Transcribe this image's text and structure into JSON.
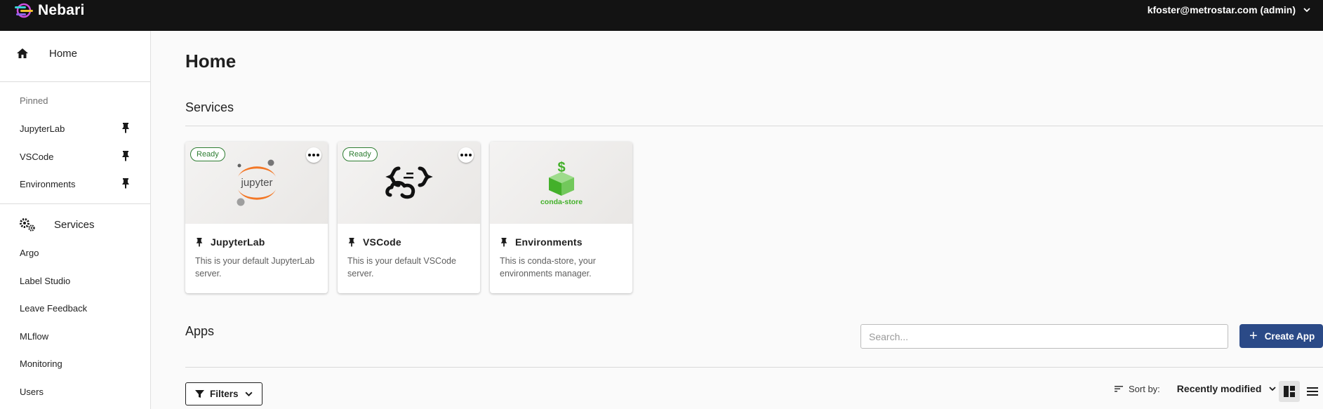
{
  "app": {
    "name": "Nebari"
  },
  "user": {
    "label": "kfoster@metrostar.com (admin)"
  },
  "sidebar": {
    "home_label": "Home",
    "pinned_heading": "Pinned",
    "pinned": [
      {
        "label": "JupyterLab"
      },
      {
        "label": "VSCode"
      },
      {
        "label": "Environments"
      }
    ],
    "services_heading": "Services",
    "services": [
      {
        "label": "Argo"
      },
      {
        "label": "Label Studio"
      },
      {
        "label": "Leave Feedback"
      },
      {
        "label": "MLflow"
      },
      {
        "label": "Monitoring"
      },
      {
        "label": "Users"
      }
    ]
  },
  "main": {
    "title": "Home",
    "services_title": "Services",
    "cards": [
      {
        "status": "Ready",
        "title": "JupyterLab",
        "description": "This is your default JupyterLab server."
      },
      {
        "status": "Ready",
        "title": "VSCode",
        "description": "This is your default VSCode server."
      },
      {
        "logo_text": "conda-store",
        "title": "Environments",
        "description": "This is conda-store, your environments manager."
      }
    ],
    "apps_title": "Apps",
    "search": {
      "placeholder": "Search..."
    },
    "create_app_label": "Create App",
    "filters_label": "Filters",
    "sort": {
      "label": "Sort by:",
      "value": "Recently modified"
    }
  },
  "colors": {
    "topbar": "#131313",
    "primary": "#2b4a87",
    "ready": "#2e7d32",
    "jupyter_orange": "#f37726",
    "conda_green": "#43b02a"
  },
  "icons": [
    "nebari-logo",
    "chevron-down-icon",
    "home-icon",
    "pin-icon",
    "gears-icon",
    "more-icon",
    "jupyter-logo",
    "vscode-logo",
    "conda-store-logo",
    "plus-icon",
    "filter-icon",
    "sort-icon",
    "grid-view-icon",
    "list-view-icon"
  ]
}
